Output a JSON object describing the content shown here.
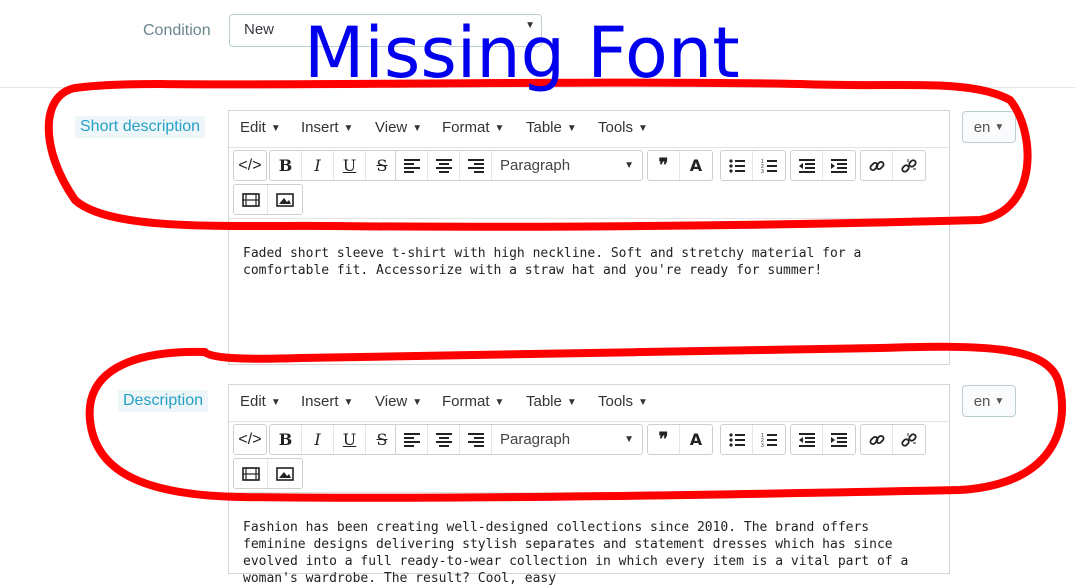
{
  "condition": {
    "label": "Condition",
    "value": "New"
  },
  "overlay_text": "Missing Font",
  "editor_menu": [
    "Edit",
    "Insert",
    "View",
    "Format",
    "Table",
    "Tools"
  ],
  "format_select": "Paragraph",
  "short_description": {
    "label": "Short description",
    "lang": "en",
    "content": "Faded short sleeve t-shirt with high neckline. Soft and stretchy material for a comfortable fit. Accessorize with a straw hat and you're ready for summer!"
  },
  "description": {
    "label": "Description",
    "lang": "en",
    "content": "Fashion has been creating well-designed collections since 2010. The brand offers feminine designs delivering stylish separates and statement dresses which has since evolved into a full ready-to-wear collection in which every item is a vital part of a woman's wardrobe. The result? Cool, easy"
  },
  "toolbar_icons": [
    "code-icon",
    "bold-icon",
    "italic-icon",
    "underline-icon",
    "strikethrough-icon",
    "align-left-icon",
    "align-center-icon",
    "align-right-icon",
    "blockquote-icon",
    "text-color-icon",
    "bullet-list-icon",
    "numbered-list-icon",
    "outdent-icon",
    "indent-icon",
    "link-icon",
    "unlink-icon",
    "video-icon",
    "image-icon"
  ],
  "colors": {
    "annotation": "#ff0000",
    "overlay_text": "#0000ee",
    "label_highlight": "#25a0c6"
  }
}
